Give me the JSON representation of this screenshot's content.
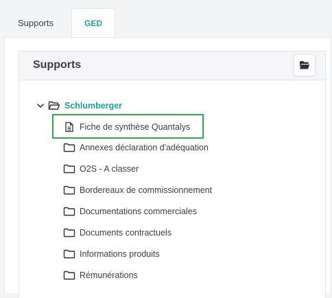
{
  "tabs": [
    {
      "label": "Supports",
      "active": false
    },
    {
      "label": "GED",
      "active": true
    }
  ],
  "card": {
    "title": "Supports",
    "folder_button_icon": "folder-open-icon"
  },
  "tree": {
    "root": {
      "label": "Schlumberger",
      "expanded": true,
      "icon": "folder-open-icon"
    },
    "children": [
      {
        "label": "Fiche de synthèse Quantalys",
        "icon": "file-text-icon",
        "selected": true
      },
      {
        "label": "Annexes déclaration d'adéquation",
        "icon": "folder-icon"
      },
      {
        "label": "O2S - A classer",
        "icon": "folder-icon"
      },
      {
        "label": "Bordereaux de commissionnement",
        "icon": "folder-icon"
      },
      {
        "label": "Documentations commerciales",
        "icon": "folder-icon"
      },
      {
        "label": "Documents contractuels",
        "icon": "folder-icon"
      },
      {
        "label": "Informations produits",
        "icon": "folder-icon"
      },
      {
        "label": "Rémunérations",
        "icon": "folder-icon"
      }
    ]
  },
  "colors": {
    "accent": "#17a39a",
    "highlight": "#2fa84a",
    "text": "#3a3d4a"
  }
}
